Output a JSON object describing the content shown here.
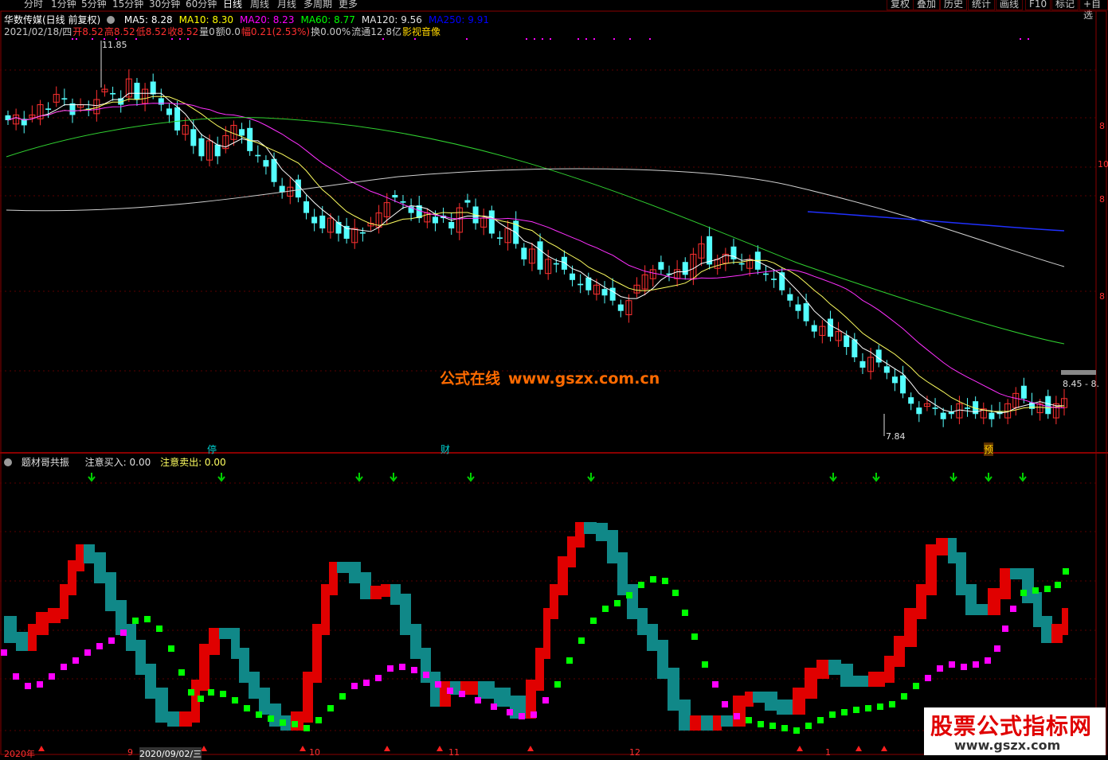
{
  "period_tabs": [
    "分时",
    "1分钟",
    "5分钟",
    "15分钟",
    "30分钟",
    "60分钟",
    "日线",
    "周线",
    "月线",
    "多周期",
    "更多"
  ],
  "active_tab": "日线",
  "right_buttons": [
    "复权",
    "叠加",
    "历史",
    "统计",
    "画线",
    "F10",
    "标记",
    "+自选"
  ],
  "stock": {
    "title": "华数传媒(日线 前复权)",
    "ma": [
      {
        "label": "MA5: 8.28",
        "color": "#ffffff"
      },
      {
        "label": "MA10: 8.30",
        "color": "#ffff00"
      },
      {
        "label": "MA20: 8.23",
        "color": "#ff00ff"
      },
      {
        "label": "MA60: 8.77",
        "color": "#00ff00"
      },
      {
        "label": "MA120: 9.56",
        "color": "#e0e0e0"
      },
      {
        "label": "MA250: 9.91",
        "color": "#0000ff"
      }
    ]
  },
  "quote": [
    {
      "text": "2021/02/18/四",
      "color": "#c8c8c8"
    },
    {
      "text": "开8.52",
      "color": "#ff3030"
    },
    {
      "text": "高8.52",
      "color": "#ff3030"
    },
    {
      "text": "低8.52",
      "color": "#ff3030"
    },
    {
      "text": "收8.52",
      "color": "#ff3030"
    },
    {
      "text": "量0",
      "color": "#c8c8c8"
    },
    {
      "text": "额0.0",
      "color": "#c8c8c8"
    },
    {
      "text": "幅0.21(2.53%)",
      "color": "#ff3030"
    },
    {
      "text": "换0.00%",
      "color": "#c8c8c8"
    },
    {
      "text": "流通12.8亿",
      "color": "#c8c8c8"
    },
    {
      "text": "影视音像",
      "color": "#ffd700"
    }
  ],
  "price_marks": {
    "high": "11.85",
    "low": "7.84",
    "last": "8.45 - 8."
  },
  "right_axis": [
    "8",
    "10",
    "8",
    "8"
  ],
  "event_marks": [
    "停",
    "财",
    "预"
  ],
  "watermark": {
    "cn": "公式在线",
    "url": "www.gszx.com.cn"
  },
  "indicator": {
    "name": "题材哥共振",
    "buy": "注意买入: 0.00",
    "sell": "注意卖出: 0.00"
  },
  "bottom_dates": [
    "2020年",
    "9",
    "2020/09/02/三",
    "10",
    "11",
    "12",
    "1"
  ],
  "logo": {
    "line1": "股票公式指标网",
    "line2": "www.gszx.com"
  },
  "colors": {
    "up_candle": "#ff3030",
    "down_candle": "#54ffff",
    "ma5": "#ffffff",
    "ma10": "#ffff60",
    "ma20": "#ff30ff",
    "ma60": "#30d030",
    "ma120": "#d0d0d0",
    "ma250": "#2030ff",
    "ind_red": "#e00000",
    "ind_teal": "#108888",
    "ind_green": "#00ff00",
    "ind_magenta": "#ff00ff",
    "frame": "#8a0000",
    "arrow": "#00d000"
  }
}
